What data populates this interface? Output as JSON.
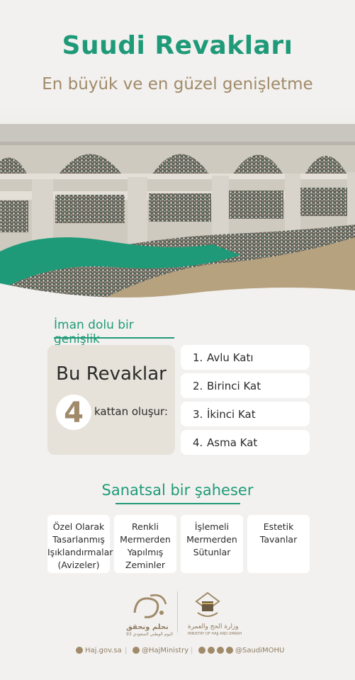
{
  "header": {
    "title": "Suudi Revakları",
    "subtitle": "En büyük ve en güzel genişletme"
  },
  "section1": {
    "heading": "İman dolu bir genişlik",
    "box_title": "Bu Revaklar",
    "number": "4",
    "box_text": "kattan oluşur:",
    "items": [
      {
        "num": "1.",
        "label": "Avlu Katı"
      },
      {
        "num": "2.",
        "label": "Birinci Kat"
      },
      {
        "num": "3.",
        "label": "İkinci Kat"
      },
      {
        "num": "4.",
        "label": "Asma Kat"
      }
    ]
  },
  "section2": {
    "heading": "Sanatsal bir şaheser",
    "cards": [
      "Özel Olarak Tasarlanmış Işıklandırmalar (Avizeler)",
      "Renkli Mermerden Yapılmış Zeminler",
      "İşlemeli Mermerden Sütunlar",
      "Estetik Tavanlar"
    ]
  },
  "logos": {
    "left_arabic": "نحلم ونحقق",
    "left_sub": "اليوم الوطني السعودي 93",
    "right_arabic": "وزارة الحج والعمرة",
    "right_sub": "MINISTRY OF HAJJ AND UMRAH"
  },
  "footer": {
    "website": "Haj.gov.sa",
    "twitter": "@HajMinistry",
    "social": "@SaudiMOHU"
  },
  "colors": {
    "green": "#1f9a78",
    "gold": "#a08a69",
    "background": "#f2f1ef"
  }
}
